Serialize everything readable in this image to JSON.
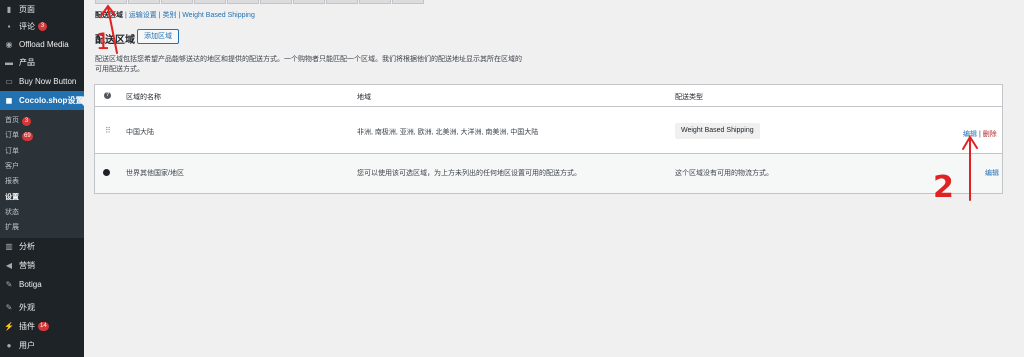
{
  "sidebar": {
    "items": [
      {
        "icon": "pages-icon",
        "label": "页面",
        "badge": ""
      },
      {
        "icon": "comments-icon",
        "label": "评论",
        "badge": "3"
      },
      {
        "icon": "offload-icon",
        "label": "Offload Media",
        "badge": ""
      },
      {
        "icon": "products-icon",
        "label": "产品",
        "badge": ""
      },
      {
        "icon": "buy-now-icon",
        "label": "Buy Now Button",
        "badge": ""
      },
      {
        "icon": "cocolo-icon",
        "label": "Cocolo.shop设置",
        "badge": ""
      }
    ],
    "submenu": [
      {
        "label": "首页",
        "badge": "3"
      },
      {
        "label": "订单",
        "badge": "69"
      },
      {
        "label": "订单",
        "badge": ""
      },
      {
        "label": "客户",
        "badge": ""
      },
      {
        "label": "报表",
        "badge": ""
      },
      {
        "label": "设置",
        "badge": ""
      },
      {
        "label": "状态",
        "badge": ""
      },
      {
        "label": "扩展",
        "badge": ""
      }
    ],
    "lower_items": [
      {
        "icon": "analytics-icon",
        "label": "分析",
        "badge": ""
      },
      {
        "icon": "marketing-icon",
        "label": "营销",
        "badge": ""
      },
      {
        "icon": "botiga-icon",
        "label": "Botiga",
        "badge": ""
      },
      {
        "icon": "appearance-icon",
        "label": "外观",
        "badge": ""
      },
      {
        "icon": "plugins-icon",
        "label": "插件",
        "badge": "14"
      },
      {
        "icon": "users-icon",
        "label": "用户",
        "badge": ""
      }
    ]
  },
  "subsubsub": {
    "zones": "配送区域",
    "sep1": "|",
    "options": "运输设置",
    "sep2": "|",
    "classes": "类别",
    "sep3": "|",
    "weight": "Weight Based Shipping"
  },
  "page": {
    "title": "配送区域",
    "add_button": "添加区域",
    "desc_line1": "配送区域包括您希望产品能够送达的地区和提供的配送方式。一个购物者只能匹配一个区域。我们将根据他们的配送地址显示其所在区域的",
    "desc_line2": "可用配送方式。"
  },
  "table": {
    "columns": [
      "区域的名称",
      "地域",
      "配送类型"
    ],
    "rows": [
      {
        "name": "中国大陆",
        "regions": "非洲, 南极洲, 亚洲, 欧洲, 北美洲, 大洋洲, 南美洲, 中国大陆",
        "method": "Weight Based Shipping",
        "edit": "编辑",
        "sep": "|",
        "delete": "删除"
      },
      {
        "name": "世界其他国家/地区",
        "regions": "您可以使用该可选区域，为上方未列出的任何地区设置可用的配送方式。",
        "method": "这个区域没有可用的物流方式。",
        "edit": "编辑"
      }
    ]
  },
  "annotations": {
    "one": "1",
    "two": "2"
  },
  "colors": {
    "accent": "#2271b1",
    "sidebar": "#1d2327",
    "badge": "#d63638",
    "annotation": "#e22222"
  }
}
